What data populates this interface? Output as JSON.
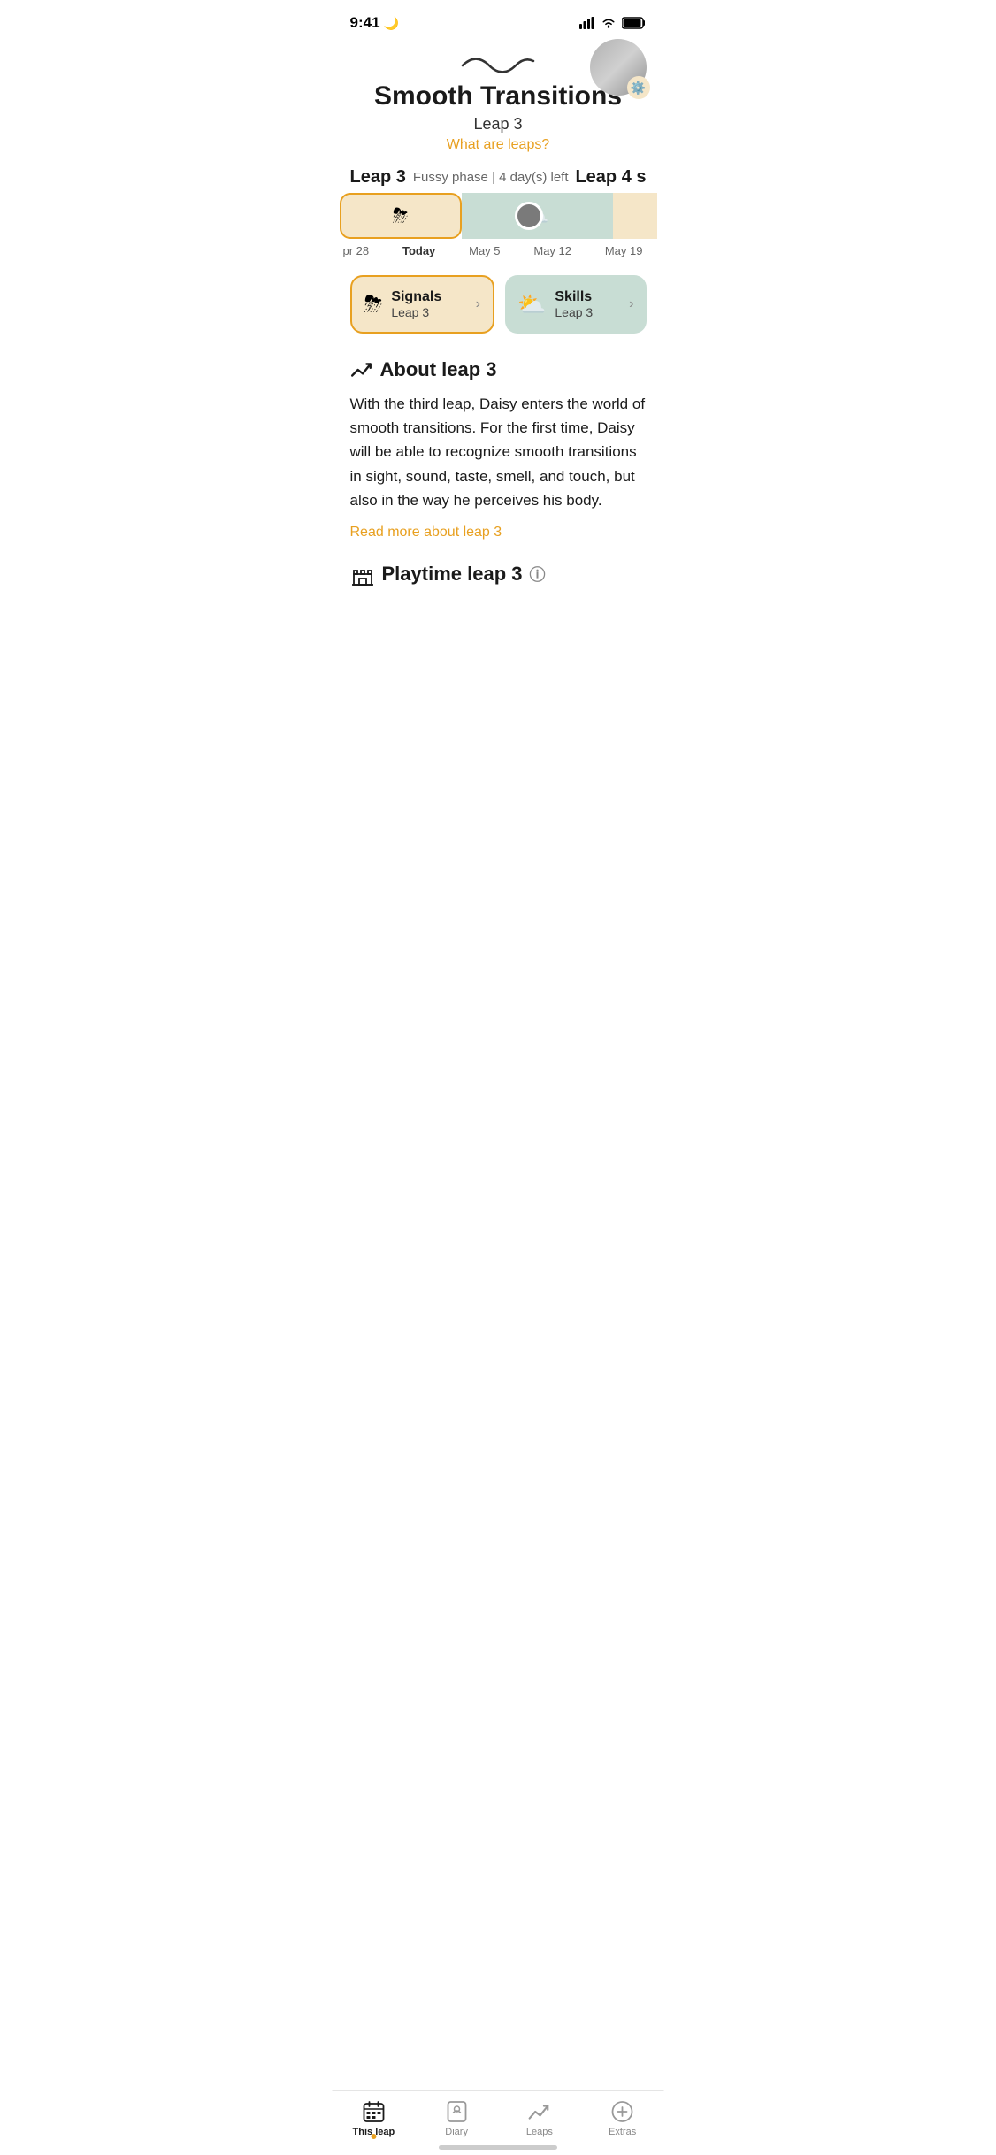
{
  "status_bar": {
    "time": "9:41",
    "moon_icon": "🌙"
  },
  "header": {
    "wave_alt": "wave symbol",
    "title": "Smooth Transitions",
    "leap_number": "Leap 3",
    "what_are_leaps": "What are leaps?"
  },
  "timeline": {
    "current_leap_label": "Leap 3",
    "fussy_text": "Fussy phase | 4 day(s) left",
    "next_leap_label": "Leap 4 s",
    "dates": [
      {
        "label": "pr 28",
        "class": ""
      },
      {
        "label": "Today",
        "class": "today"
      },
      {
        "label": "May 5",
        "class": ""
      },
      {
        "label": "May 12",
        "class": ""
      },
      {
        "label": "May 19",
        "class": ""
      }
    ],
    "storm_icon": "⛈",
    "cloud_sun_icon": "⛅"
  },
  "cards": [
    {
      "id": "signals",
      "icon": "⛈",
      "title": "Signals",
      "leap": "Leap 3",
      "arrow": "›"
    },
    {
      "id": "skills",
      "icon": "⛅",
      "title": "Skills",
      "leap": "Leap 3",
      "arrow": "›"
    }
  ],
  "about_section": {
    "icon": "📈",
    "title": "About leap 3",
    "body": "With the third leap, Daisy  enters the world of smooth transitions. For the first time, Daisy will be able to recognize smooth transitions in sight, sound, taste, smell, and touch, but also in the way he perceives his body.",
    "read_more": "Read more about leap 3"
  },
  "playtime_section": {
    "icon": "🏛",
    "title": "Playtime leap 3",
    "info_icon": "ⓘ"
  },
  "bottom_nav": {
    "items": [
      {
        "id": "this-leap",
        "icon": "📅",
        "label": "This leap",
        "active": true,
        "has_dot": true
      },
      {
        "id": "diary",
        "icon": "📔",
        "label": "Diary",
        "active": false,
        "has_dot": false
      },
      {
        "id": "leaps",
        "icon": "📈",
        "label": "Leaps",
        "active": false,
        "has_dot": false
      },
      {
        "id": "extras",
        "icon": "➕",
        "label": "Extras",
        "active": false,
        "has_dot": false
      }
    ]
  },
  "colors": {
    "yellow_border": "#e8a020",
    "yellow_bg": "#f5e6c8",
    "green_bg": "#c8ddd4",
    "orange_link": "#e8a020"
  }
}
